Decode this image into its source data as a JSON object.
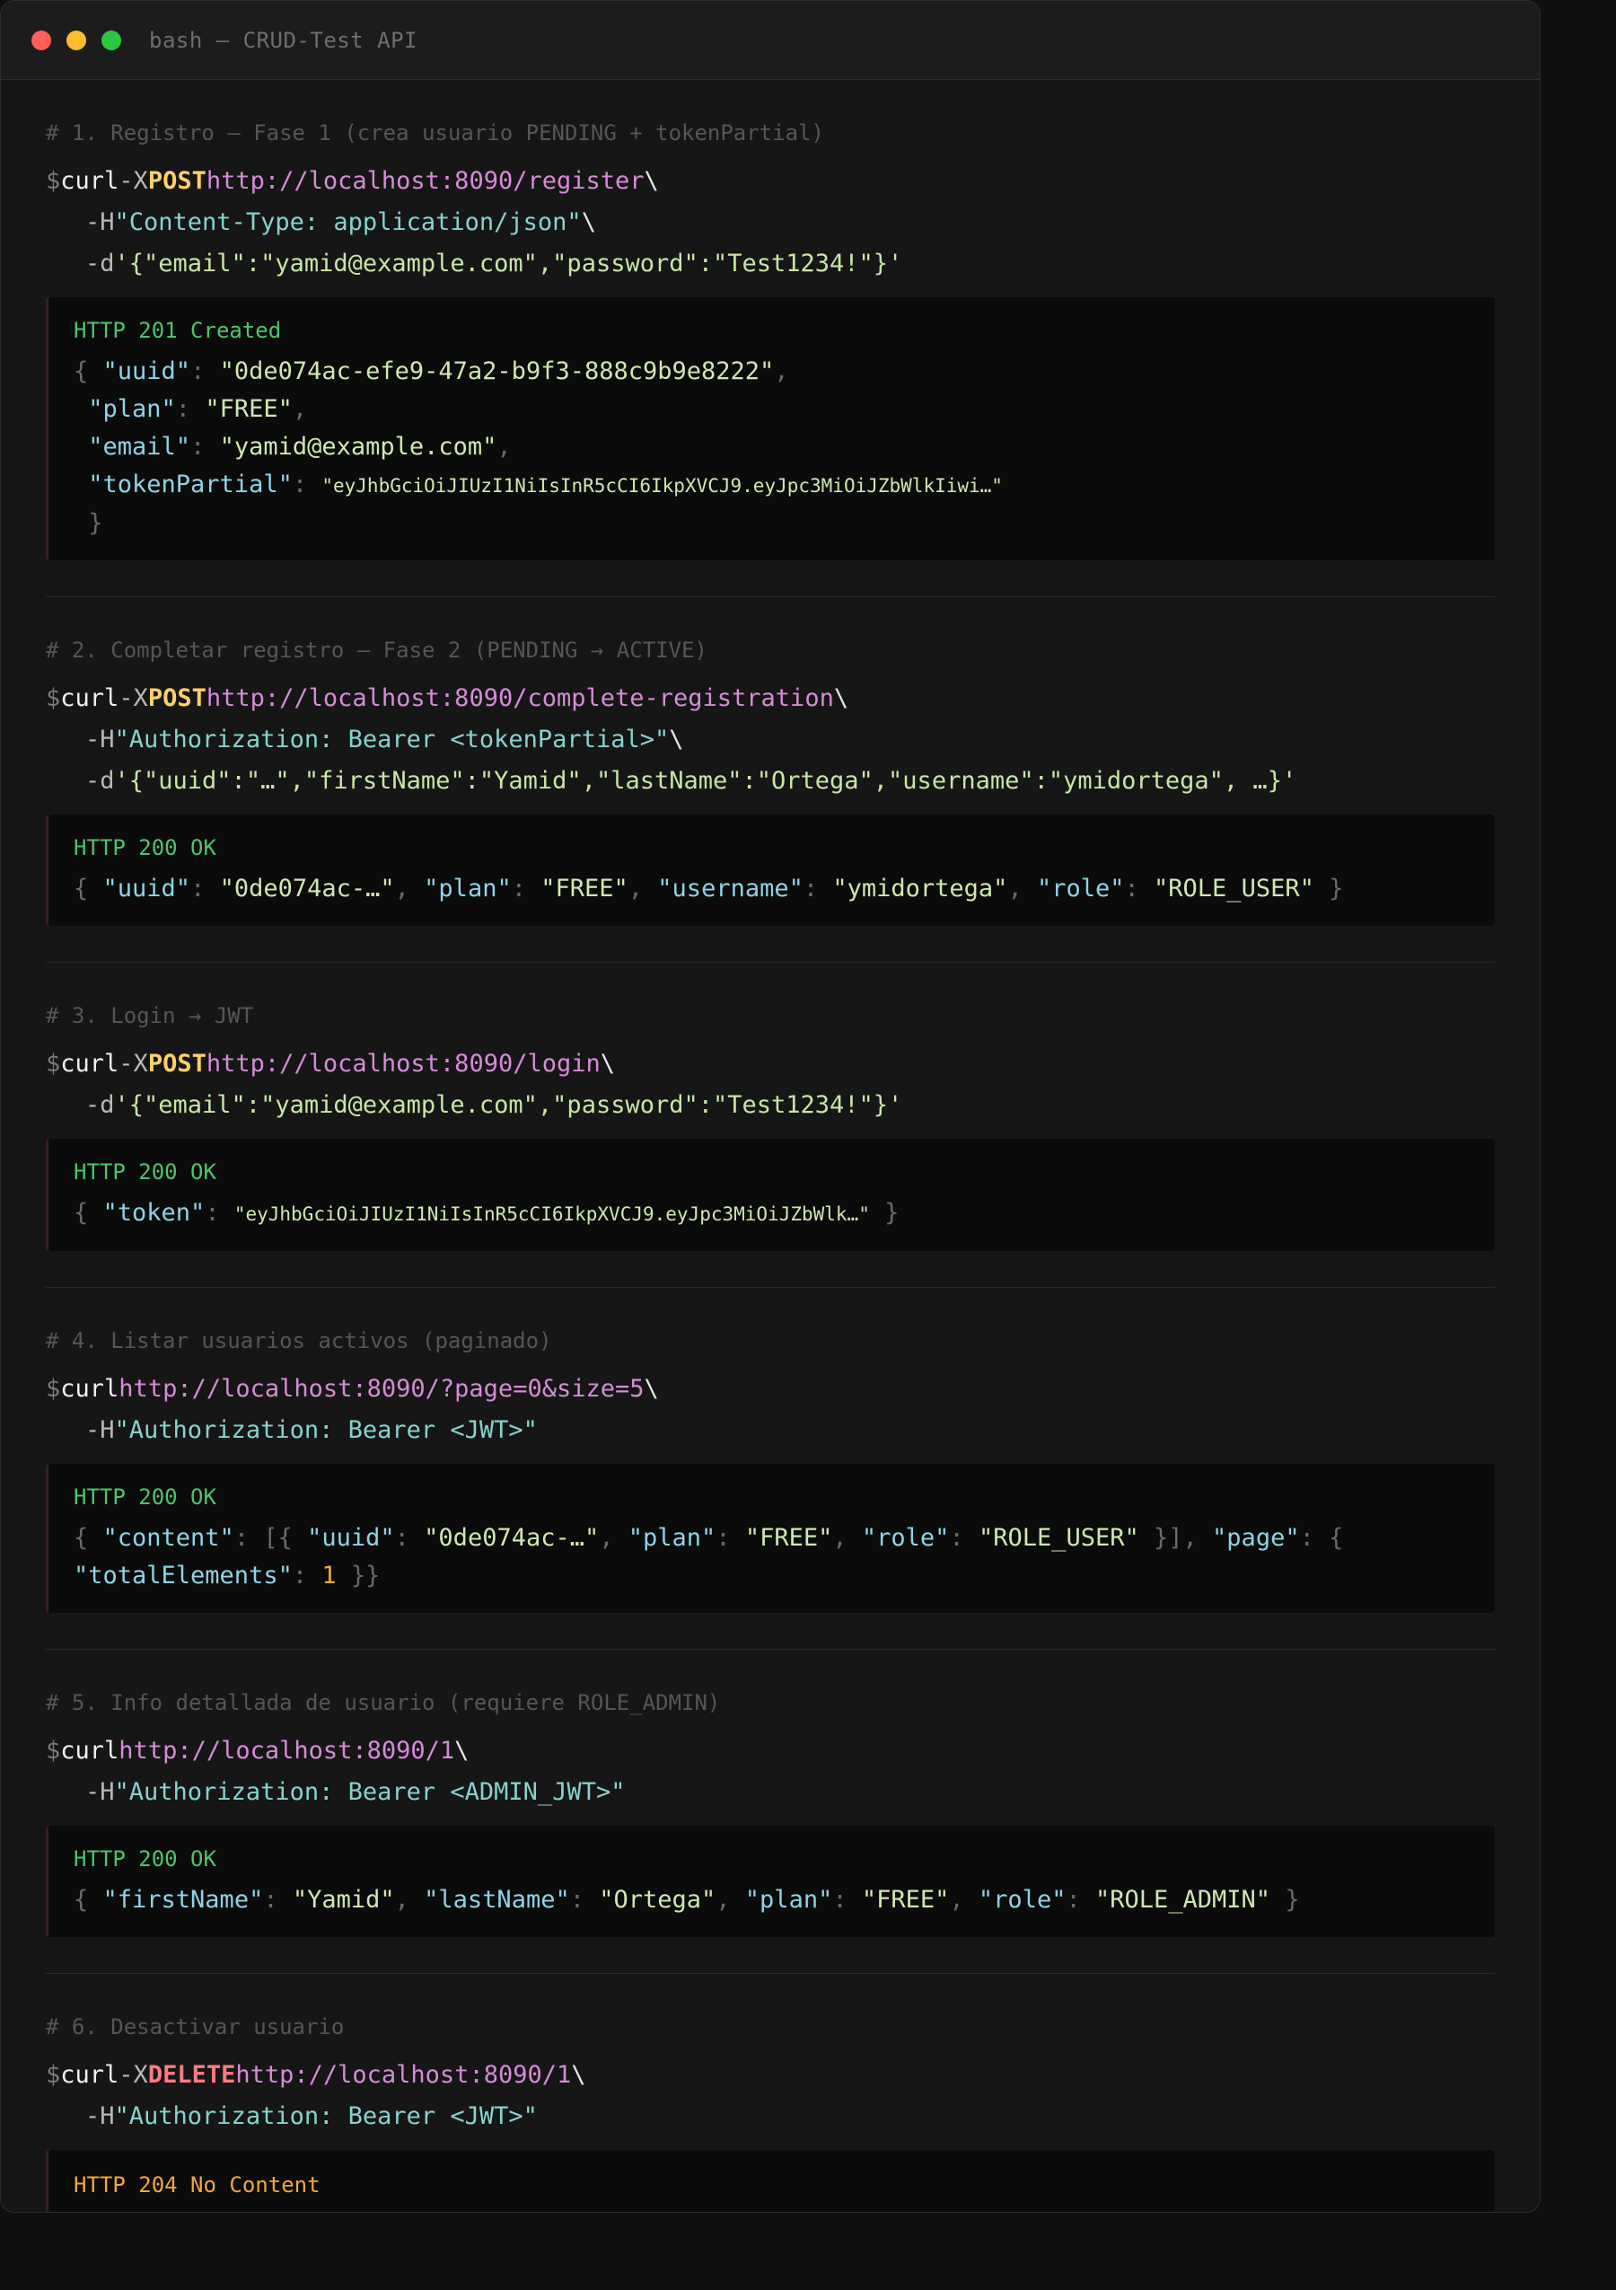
{
  "window": {
    "title": "bash — CRUD-Test API"
  },
  "prompt": "$",
  "sections": [
    {
      "comment": "# 1. Registro — Fase 1 (crea usuario PENDING + tokenPartial)",
      "cmd": {
        "curl": "curl",
        "flag_x": "-X",
        "method": "POST",
        "url": "http://localhost:8090/register",
        "bs": "\\"
      },
      "lines": [
        {
          "flag": "-H",
          "value": "\"Content-Type: application/json\"",
          "bs": "\\"
        },
        {
          "flag": "-d",
          "value": "'{\"email\":\"yamid@example.com\",\"password\":\"Test1234!\"}'"
        }
      ],
      "status": "HTTP 201 Created",
      "json": {
        "uuid": "\"0de074ac-efe9-47a2-b9f3-888c9b9e8222\"",
        "plan": "\"FREE\"",
        "email": "\"yamid@example.com\"",
        "tokenPartial": "\"eyJhbGciOiJIUzI1NiIsInR5cCI6IkpXVCJ9.eyJpc3MiOiJZbWlkIiwi…\""
      }
    },
    {
      "comment": "# 2. Completar registro — Fase 2 (PENDING → ACTIVE)",
      "cmd": {
        "curl": "curl",
        "flag_x": "-X",
        "method": "POST",
        "url": "http://localhost:8090/complete-registration",
        "bs": "\\"
      },
      "lines": [
        {
          "flag": "-H",
          "value": "\"Authorization: Bearer <tokenPartial>\"",
          "bs": "\\"
        },
        {
          "flag": "-d",
          "value": "'{\"uuid\":\"…\",\"firstName\":\"Yamid\",\"lastName\":\"Ortega\",\"username\":\"ymidortega\", …}'"
        }
      ],
      "status": "HTTP 200 OK",
      "json": {
        "uuid": "\"0de074ac-…\"",
        "plan": "\"FREE\"",
        "username": "\"ymidortega\"",
        "role": "\"ROLE_USER\""
      }
    },
    {
      "comment": "# 3. Login → JWT",
      "cmd": {
        "curl": "curl",
        "flag_x": "-X",
        "method": "POST",
        "url": "http://localhost:8090/login",
        "bs": "\\"
      },
      "lines": [
        {
          "flag": "-d",
          "value": "'{\"email\":\"yamid@example.com\",\"password\":\"Test1234!\"}'"
        }
      ],
      "status": "HTTP 200 OK",
      "json": {
        "token": "\"eyJhbGciOiJIUzI1NiIsInR5cCI6IkpXVCJ9.eyJpc3MiOiJZbWlk…\""
      }
    },
    {
      "comment": "# 4. Listar usuarios activos (paginado)",
      "cmd": {
        "curl": "curl",
        "url": "http://localhost:8090/?page=0&size=5",
        "bs": "\\"
      },
      "lines": [
        {
          "flag": "-H",
          "value": "\"Authorization: Bearer <JWT>\""
        }
      ],
      "status": "HTTP 200 OK",
      "json": {
        "uuid": "\"0de074ac-…\"",
        "plan": "\"FREE\"",
        "role": "\"ROLE_USER\"",
        "totalElements": "1"
      }
    },
    {
      "comment": "# 5. Info detallada de usuario (requiere ROLE_ADMIN)",
      "cmd": {
        "curl": "curl",
        "url": "http://localhost:8090/1",
        "bs": "\\"
      },
      "lines": [
        {
          "flag": "-H",
          "value": "\"Authorization: Bearer <ADMIN_JWT>\""
        }
      ],
      "status": "HTTP 200 OK",
      "json": {
        "firstName": "\"Yamid\"",
        "lastName": "\"Ortega\"",
        "plan": "\"FREE\"",
        "role": "\"ROLE_ADMIN\""
      }
    },
    {
      "comment": "# 6. Desactivar usuario",
      "cmd": {
        "curl": "curl",
        "flag_x": "-X",
        "method": "DELETE",
        "url": "http://localhost:8090/1",
        "bs": "\\"
      },
      "lines": [
        {
          "flag": "-H",
          "value": "\"Authorization: Bearer <JWT>\""
        }
      ],
      "status": "HTTP 204 No Content"
    }
  ],
  "colors": {
    "window_bg": "#161616",
    "titlebar_bg": "#1c1c1c",
    "close_dot": "#ff5f57",
    "minimize_dot": "#febc2e",
    "zoom_dot": "#28c840",
    "method_post": "#ffd166",
    "method_delete": "#ff7b82",
    "url": "#d68bd8",
    "status_ok": "#4cc66a",
    "status_no_content": "#f4a73a"
  }
}
